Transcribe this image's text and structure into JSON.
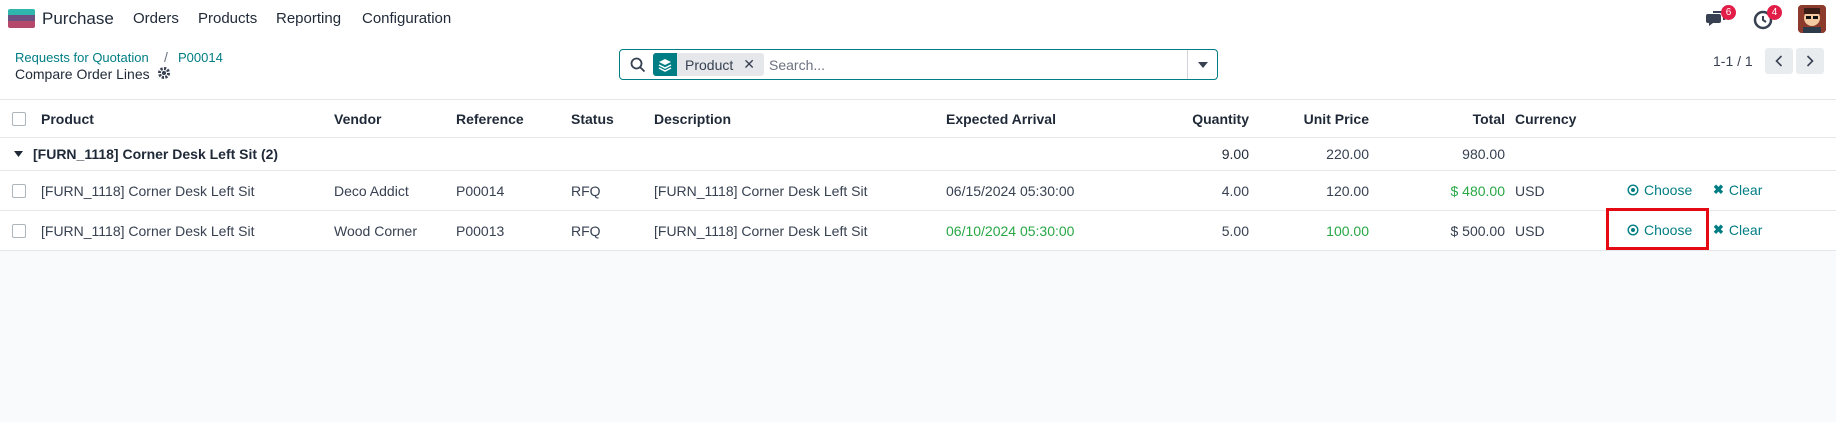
{
  "navbar": {
    "app_name": "Purchase",
    "menu": [
      "Orders",
      "Products",
      "Reporting",
      "Configuration"
    ],
    "messages_badge": "6",
    "activities_badge": "4"
  },
  "breadcrumb": {
    "parent": "Requests for Quotation",
    "current": "P00014",
    "subtitle": "Compare Order Lines"
  },
  "search": {
    "facet_label": "Product",
    "placeholder": "Search..."
  },
  "pager": {
    "value": "1-1 / 1"
  },
  "table": {
    "headers": {
      "product": "Product",
      "vendor": "Vendor",
      "reference": "Reference",
      "status": "Status",
      "description": "Description",
      "expected_arrival": "Expected Arrival",
      "quantity": "Quantity",
      "unit_price": "Unit Price",
      "total": "Total",
      "currency": "Currency"
    },
    "group": {
      "label": "[FURN_1118] Corner Desk Left Sit (2)",
      "quantity": "9.00",
      "unit_price": "220.00",
      "total": "980.00"
    },
    "rows": [
      {
        "product": "[FURN_1118] Corner Desk Left Sit",
        "vendor": "Deco Addict",
        "reference": "P00014",
        "status": "RFQ",
        "description": "[FURN_1118] Corner Desk Left Sit",
        "expected_arrival": "06/15/2024 05:30:00",
        "quantity": "4.00",
        "unit_price": "120.00",
        "total": "$ 480.00",
        "currency": "USD",
        "choose": "Choose",
        "clear": "Clear"
      },
      {
        "product": "[FURN_1118] Corner Desk Left Sit",
        "vendor": "Wood Corner",
        "reference": "P00013",
        "status": "RFQ",
        "description": "[FURN_1118] Corner Desk Left Sit",
        "expected_arrival": "06/10/2024 05:30:00",
        "quantity": "5.00",
        "unit_price": "100.00",
        "total": "$ 500.00",
        "currency": "USD",
        "choose": "Choose",
        "clear": "Clear"
      }
    ]
  },
  "colors": {
    "accent": "#017e84",
    "positive": "#28a745",
    "highlight": "#e50914",
    "badge": "#e11d48"
  },
  "icons": [
    "app-icon",
    "messages-icon",
    "clock-icon",
    "search-icon",
    "layers-icon",
    "close-icon",
    "caret-down-icon",
    "chevron-left-icon",
    "chevron-right-icon",
    "gear-icon",
    "target-icon",
    "times-icon"
  ]
}
